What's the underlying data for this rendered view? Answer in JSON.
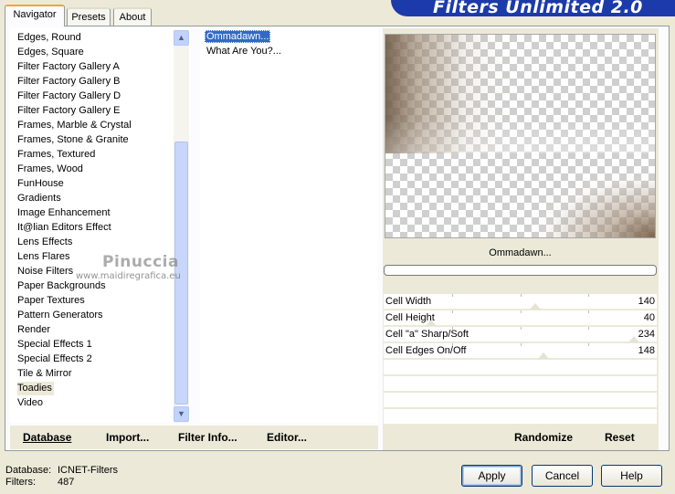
{
  "tabs": [
    {
      "label": "Navigator",
      "active": true
    },
    {
      "label": "Presets",
      "active": false
    },
    {
      "label": "About",
      "active": false
    }
  ],
  "banner": {
    "title": "Filters Unlimited 2.0",
    "color": "#1c3aa9"
  },
  "categories": {
    "items": [
      "Edges, Round",
      "Edges, Square",
      "Filter Factory Gallery A",
      "Filter Factory Gallery B",
      "Filter Factory Gallery D",
      "Filter Factory Gallery E",
      "Frames, Marble & Crystal",
      "Frames, Stone & Granite",
      "Frames, Textured",
      "Frames, Wood",
      "FunHouse",
      "Gradients",
      "Image Enhancement",
      "It@lian Editors Effect",
      "Lens Effects",
      "Lens Flares",
      "Noise Filters",
      "Paper Backgrounds",
      "Paper Textures",
      "Pattern Generators",
      "Render",
      "Special Effects 1",
      "Special Effects 2",
      "Tile & Mirror",
      "Toadies",
      "Video"
    ],
    "selected": "Toadies"
  },
  "filters": {
    "items": [
      "Ommadawn...",
      "What Are You?..."
    ],
    "selected": "Ommadawn..."
  },
  "watermark": {
    "name": "Pinuccia",
    "site": "www.maidiregrafica.eu"
  },
  "preview": {
    "filter_name": "Ommadawn..."
  },
  "params": [
    {
      "label": "Cell Width",
      "value": "140",
      "level": 140
    },
    {
      "label": "Cell Height",
      "value": "40",
      "level": 40
    },
    {
      "label": "Cell \"a\" Sharp/Soft",
      "value": "234",
      "level": 234
    },
    {
      "label": "Cell Edges On/Off",
      "value": "148",
      "level": 148
    }
  ],
  "left_actions": {
    "database": "Database",
    "import": "Import...",
    "filter_info": "Filter Info...",
    "editor": "Editor..."
  },
  "right_actions": {
    "randomize": "Randomize",
    "reset": "Reset"
  },
  "footer": {
    "database_label": "Database:",
    "database_value": "ICNET-Filters",
    "filters_label": "Filters:",
    "filters_value": "487"
  },
  "buttons": {
    "apply": "Apply",
    "cancel": "Cancel",
    "help": "Help"
  }
}
